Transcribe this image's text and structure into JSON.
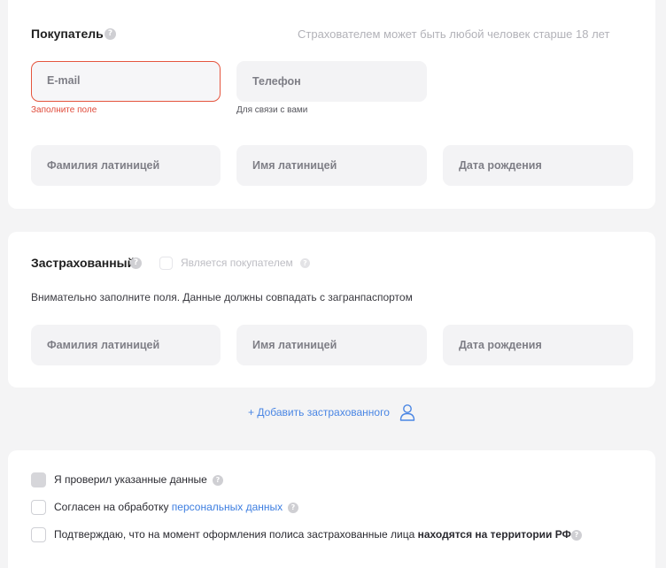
{
  "buyer": {
    "title": "Покупатель",
    "hint": "Страхователем может быть любой человек старше 18 лет",
    "fields": {
      "email": {
        "placeholder": "E-mail",
        "error": "Заполните поле"
      },
      "phone": {
        "placeholder": "Телефон",
        "note": "Для связи с вами"
      },
      "last_name": {
        "placeholder": "Фамилия латиницей"
      },
      "first_name": {
        "placeholder": "Имя латиницей"
      },
      "birth_date": {
        "placeholder": "Дата рождения"
      }
    }
  },
  "insured": {
    "title": "Застрахованный",
    "is_buyer_label": "Является покупателем",
    "description": "Внимательно заполните поля. Данные должны совпадать с загранпаспортом",
    "fields": {
      "last_name": {
        "placeholder": "Фамилия латиницей"
      },
      "first_name": {
        "placeholder": "Имя латиницей"
      },
      "birth_date": {
        "placeholder": "Дата рождения"
      }
    }
  },
  "add_insured_label": "+ Добавить застрахованного",
  "consents": {
    "verified": {
      "label": "Я проверил указанные данные"
    },
    "personal_data": {
      "label_prefix": "Согласен на обработку ",
      "link": "персональных данных"
    },
    "territory": {
      "label_prefix": "Подтверждаю, что на момент оформления полиса застрахованные лица ",
      "label_bold": "находятся на территории РФ"
    }
  },
  "icons": {
    "help": "question-mark-icon",
    "person": "person-icon"
  },
  "colors": {
    "error": "#e5553e",
    "link": "#3d7ee0",
    "background": "#f4f4f5"
  }
}
